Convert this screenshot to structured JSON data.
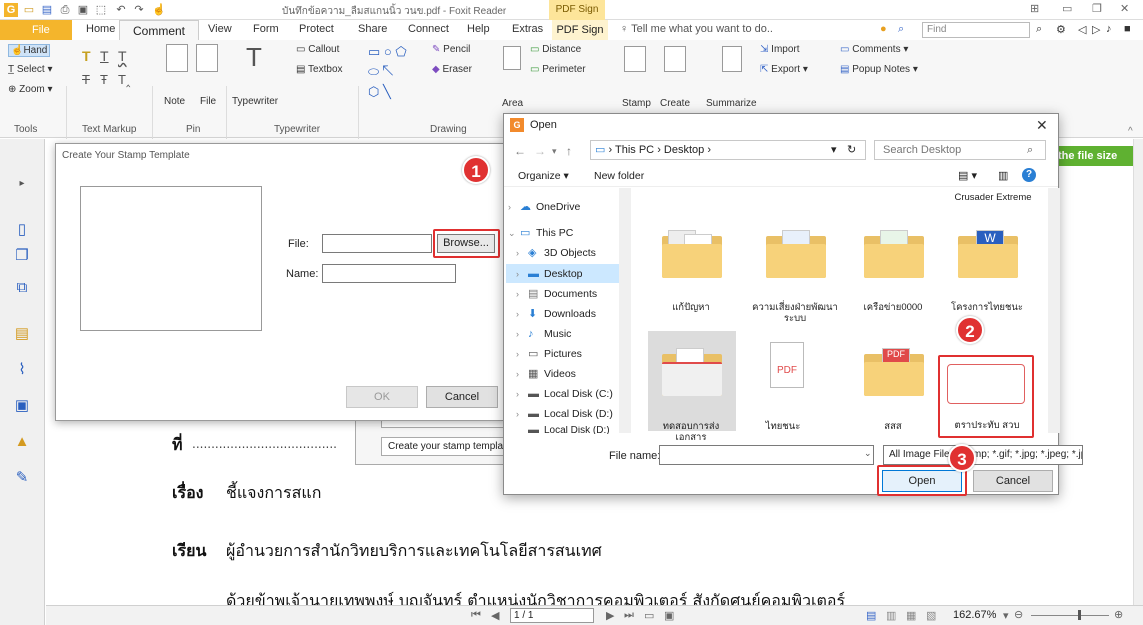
{
  "window": {
    "title": "บันทึกข้อความ_ลืมสแกนนิ้ว วนข.pdf - Foxit Reader",
    "context_tab": "PDF Sign"
  },
  "ribbon": {
    "tabs": [
      "File",
      "Home",
      "Comment",
      "View",
      "Form",
      "Protect",
      "Share",
      "Connect",
      "Help",
      "Extras",
      "PDF Sign"
    ],
    "active_tab": "Comment",
    "tell_me": "Tell me what you want to do..",
    "find_placeholder": "Find",
    "tools": {
      "hand": "Hand",
      "select": "Select",
      "zoom": "Zoom",
      "group": "Tools"
    },
    "text_markup": {
      "group": "Text Markup"
    },
    "pin": {
      "note": "Note",
      "file": "File",
      "group": "Pin"
    },
    "typewriter": {
      "typewriter": "Typewriter",
      "callout": "Callout",
      "textbox": "Textbox",
      "group": "Typewriter"
    },
    "drawing": {
      "pencil": "Pencil",
      "eraser": "Eraser",
      "area": "Area",
      "group": "Drawing"
    },
    "measure": {
      "distance": "Distance",
      "perimeter": "Perimeter"
    },
    "stamp": {
      "stamp": "Stamp",
      "create": "Create"
    },
    "summarize": {
      "summarize": "Summarize",
      "import": "Import",
      "export": "Export"
    },
    "comments": {
      "comments": "Comments",
      "popup_notes": "Popup Notes"
    }
  },
  "banner": {
    "file_size": "the file size"
  },
  "document": {
    "line_ti": "ที่",
    "ti_dots": "......................................",
    "line_rueang_label": "เรื่อง",
    "line_rueang_text": "ชี้แจงการสแก",
    "line_rian_label": "เรียน",
    "line_rian_text": "ผู้อำนวยการสำนักวิทยบริการและเทคโนโลยีสารสนเทศ",
    "line_body": "ด้วยข้าพเจ้านายเทพพงษ์ บุญจันทร์ ตำแหน่งนักวิชาการคอมพิวเตอร์ สังกัดศูนย์คอมพิวเตอร์"
  },
  "status": {
    "page": "1 / 1",
    "zoom": "162.67%"
  },
  "stamp_dialog": {
    "title": "Create Your Stamp Template",
    "file_label": "File:",
    "name_label": "Name:",
    "browse": "Browse...",
    "ok": "OK",
    "cancel": "Cancel"
  },
  "behind_dialog": {
    "row1": "",
    "row2": "Create your stamp templa"
  },
  "open_dialog": {
    "title": "Open",
    "address": [
      "This PC",
      "Desktop"
    ],
    "search_placeholder": "Search Desktop",
    "organize": "Organize ▾",
    "new_folder": "New folder",
    "nav": [
      {
        "label": "OneDrive",
        "icon": "cloud"
      },
      {
        "label": "This PC",
        "icon": "pc"
      },
      {
        "label": "3D Objects",
        "icon": "cube"
      },
      {
        "label": "Desktop",
        "icon": "desktop"
      },
      {
        "label": "Documents",
        "icon": "doc"
      },
      {
        "label": "Downloads",
        "icon": "download"
      },
      {
        "label": "Music",
        "icon": "music"
      },
      {
        "label": "Pictures",
        "icon": "picture"
      },
      {
        "label": "Videos",
        "icon": "video"
      },
      {
        "label": "Local Disk (C:)",
        "icon": "disk"
      },
      {
        "label": "Local Disk (D:)",
        "icon": "disk"
      },
      {
        "label": "Local Disk (D:)",
        "icon": "disk"
      }
    ],
    "top_label": "Crusader Extreme",
    "files": [
      "แก้ปัญหา",
      "ความเสี่ยงฝ่ายพัฒนาระบบ",
      "เครือข่าย0000",
      "โครงการไทยชนะ",
      "ทดสอบการส่งเอกสาร",
      "ไทยชนะ",
      "สสส",
      "ตราประทับ สวบ"
    ],
    "file_name_label": "File name:",
    "filter": "All Image Files (*.bmp; *.gif; *.jpg; *.jpeg; *.jpe; *.png; *.tif;",
    "open": "Open",
    "cancel": "Cancel"
  },
  "steps": [
    "1",
    "2",
    "3"
  ],
  "colors": {
    "accent": "#f4b52c",
    "highlight": "#e03030",
    "selection": "#cce8ff",
    "banner": "#5fb131"
  }
}
